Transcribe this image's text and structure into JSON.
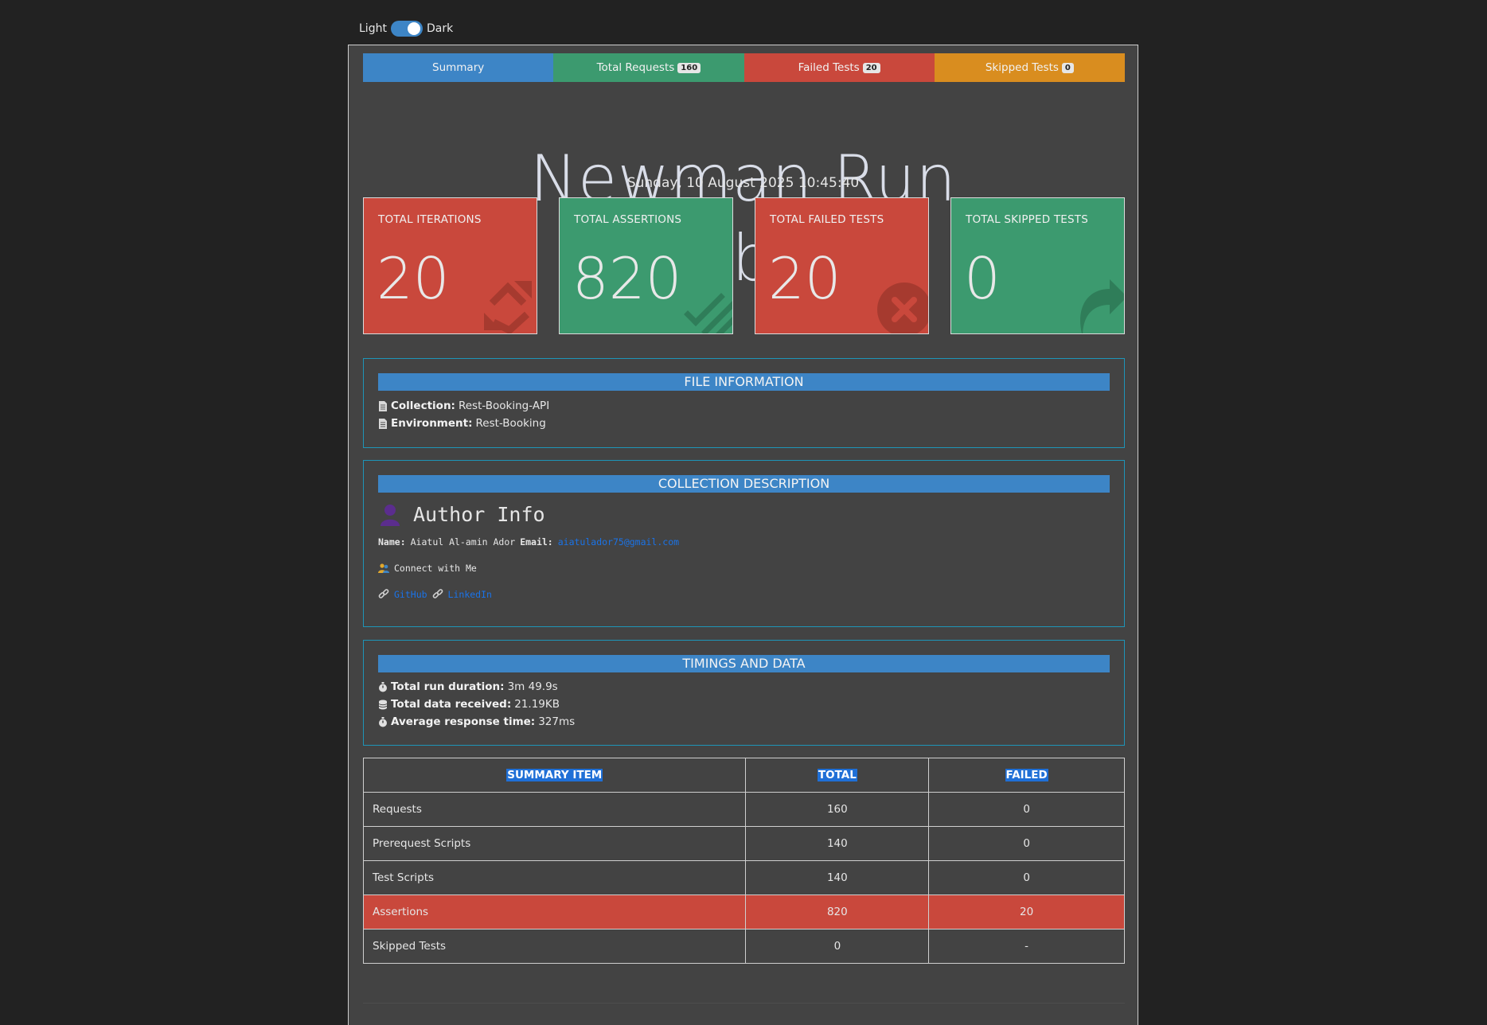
{
  "theme": {
    "light_label": "Light",
    "dark_label": "Dark"
  },
  "tabs": [
    {
      "label": "Summary",
      "badge": ""
    },
    {
      "label": "Total Requests",
      "badge": "160"
    },
    {
      "label": "Failed Tests",
      "badge": "20"
    },
    {
      "label": "Skipped Tests",
      "badge": "0"
    }
  ],
  "header": {
    "title": "Newman Run Dashboard",
    "date": "Sunday, 10 August 2025 10:45:40"
  },
  "cards": [
    {
      "label": "TOTAL ITERATIONS",
      "value": "20",
      "icon": "refresh-icon",
      "color": "#c9483c"
    },
    {
      "label": "TOTAL ASSERTIONS",
      "value": "820",
      "icon": "tasks-icon",
      "color": "#3c9a6f"
    },
    {
      "label": "TOTAL FAILED TESTS",
      "value": "20",
      "icon": "times-circle-icon",
      "color": "#c9483c"
    },
    {
      "label": "TOTAL SKIPPED TESTS",
      "value": "0",
      "icon": "share-icon",
      "color": "#3c9a6f"
    }
  ],
  "file_info": {
    "heading": "FILE INFORMATION",
    "collection_label": "Collection:",
    "collection_value": "Rest-Booking-API",
    "environment_label": "Environment:",
    "environment_value": "Rest-Booking"
  },
  "description": {
    "heading": "COLLECTION DESCRIPTION",
    "author_title": "Author Info",
    "name_label": "Name:",
    "name_value": "Aiatul Al-amin Ador",
    "email_label": "Email:",
    "email_value": "aiatulador75@gmail.com",
    "connect_text": "Connect with Me",
    "github": "GitHub",
    "linkedin": "LinkedIn"
  },
  "timings": {
    "heading": "TIMINGS AND DATA",
    "duration_label": "Total run duration:",
    "duration_value": "3m 49.9s",
    "data_label": "Total data received:",
    "data_value": "21.19KB",
    "response_label": "Average response time:",
    "response_value": "327ms"
  },
  "summary_table": {
    "headers": [
      "SUMMARY ITEM",
      "TOTAL",
      "FAILED"
    ],
    "rows": [
      {
        "item": "Requests",
        "total": "160",
        "failed": "0"
      },
      {
        "item": "Prerequest Scripts",
        "total": "140",
        "failed": "0"
      },
      {
        "item": "Test Scripts",
        "total": "140",
        "failed": "0"
      },
      {
        "item": "Assertions",
        "total": "820",
        "failed": "20"
      },
      {
        "item": "Skipped Tests",
        "total": "0",
        "failed": "-"
      }
    ]
  }
}
